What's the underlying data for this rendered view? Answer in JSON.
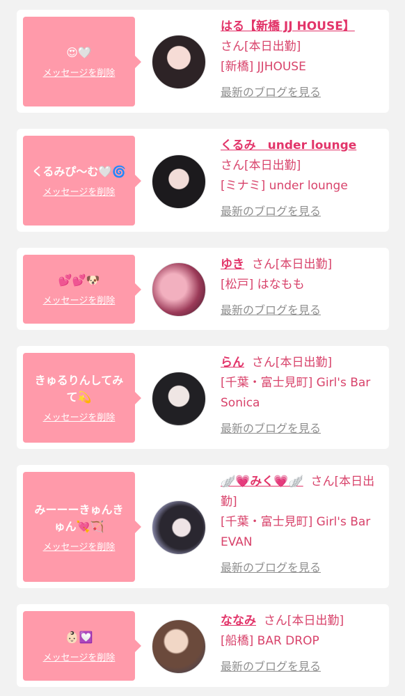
{
  "delete_label": "メッセージを削除",
  "blog_label": "最新のブログを見る",
  "colors": {
    "bubble": "#ff9aaa",
    "name": "#e2356a",
    "text": "#d8436b",
    "link": "#8f8f8f",
    "bg": "#f2f2f2"
  },
  "entries": [
    {
      "message": "😍🤍",
      "name": "はる【新橋 JJ HOUSE】",
      "status": "さん[本日出勤]",
      "shop_line1": "[新橋] JJHOUSE",
      "shop_line2": ""
    },
    {
      "message": "くるみぴ〜む🤍🌀",
      "name": "くるみ　under lounge",
      "status": "さん[本日出勤]",
      "shop_line1": "[ミナミ] under lounge",
      "shop_line2": ""
    },
    {
      "message": "💕💕🐶",
      "name": "ゆき",
      "status": "さん[本日出勤]",
      "shop_line1": "[松戸] はなもも",
      "shop_line2": ""
    },
    {
      "message": "きゅるりんしてみて💫",
      "name": "らん",
      "status": "さん[本日出勤]",
      "shop_line1": "[千葉・富士見町] Girl's Bar",
      "shop_line2": "Sonica"
    },
    {
      "message": "みーーーきゅんきゅん💘🏹",
      "name": "🪽💗みく💗🪽",
      "status": "さん[本日出勤]",
      "shop_line1": "[千葉・富士見町] Girl's Bar",
      "shop_line2": "EVAN"
    },
    {
      "message": "👶🏻💟",
      "name": "ななみ",
      "status": "さん[本日出勤]",
      "shop_line1": "[船橋] BAR DROP",
      "shop_line2": ""
    }
  ]
}
